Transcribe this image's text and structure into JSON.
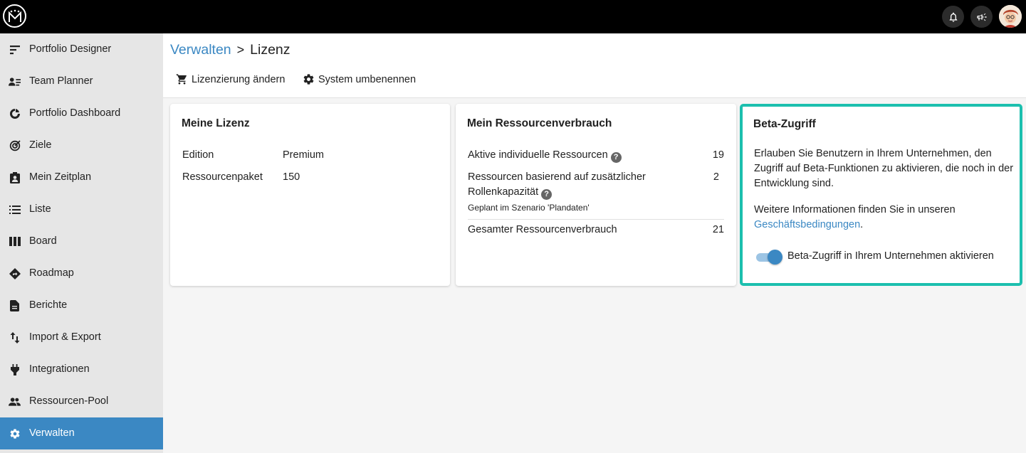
{
  "topbar": {
    "logo_text": "M",
    "icons": [
      "bell-icon",
      "megaphone-icon"
    ]
  },
  "sidebar": {
    "items": [
      {
        "label": "Portfolio Designer",
        "icon": "portfolio-designer-icon"
      },
      {
        "label": "Team Planner",
        "icon": "team-planner-icon"
      },
      {
        "label": "Portfolio Dashboard",
        "icon": "dashboard-icon"
      },
      {
        "label": "Ziele",
        "icon": "target-icon"
      },
      {
        "label": "Mein Zeitplan",
        "icon": "contact-badge-icon"
      },
      {
        "label": "Liste",
        "icon": "list-icon"
      },
      {
        "label": "Board",
        "icon": "board-icon"
      },
      {
        "label": "Roadmap",
        "icon": "roadmap-icon"
      },
      {
        "label": "Berichte",
        "icon": "report-icon"
      },
      {
        "label": "Import & Export",
        "icon": "import-export-icon"
      },
      {
        "label": "Integrationen",
        "icon": "plug-icon"
      },
      {
        "label": "Ressourcen-Pool",
        "icon": "people-icon"
      },
      {
        "label": "Verwalten",
        "icon": "gear-icon",
        "active": true
      }
    ]
  },
  "breadcrumb": {
    "parent": "Verwalten",
    "separator": ">",
    "current": "Lizenz"
  },
  "actions": {
    "change_license": "Lizenzierung ändern",
    "rename_system": "System umbenennen"
  },
  "license_card": {
    "title": "Meine Lizenz",
    "rows": [
      {
        "label": "Edition",
        "value": "Premium"
      },
      {
        "label": "Ressourcenpaket",
        "value": "150"
      }
    ]
  },
  "usage_card": {
    "title": "Mein Ressourcenverbrauch",
    "active_label": "Aktive individuelle Ressourcen",
    "active_value": "19",
    "role_label_line1": "Ressourcen basierend auf zusätzlicher",
    "role_label_line2": "Rollenkapazität",
    "role_value": "2",
    "role_note": "Geplant im Szenario 'Plandaten'",
    "total_label": "Gesamter Ressourcenverbrauch",
    "total_value": "21"
  },
  "beta_card": {
    "title": "Beta-Zugriff",
    "description_line1": "Erlauben Sie Benutzern in Ihrem Unternehmen, den",
    "description_line2": "Zugriff auf Beta-Funktionen zu aktivieren, die noch in der",
    "description_line3": "Entwicklung sind.",
    "info_text": "Weitere Informationen finden Sie in unseren",
    "info_link": "Geschäftsbedingungen",
    "info_suffix": ".",
    "toggle_label": "Beta-Zugriff in Ihrem Unternehmen aktivieren",
    "toggle_on": true
  },
  "colors": {
    "accent": "#3b88c3",
    "highlight_border": "#1cbfae",
    "topbar": "#000000",
    "sidebar": "#e6e6e6"
  }
}
